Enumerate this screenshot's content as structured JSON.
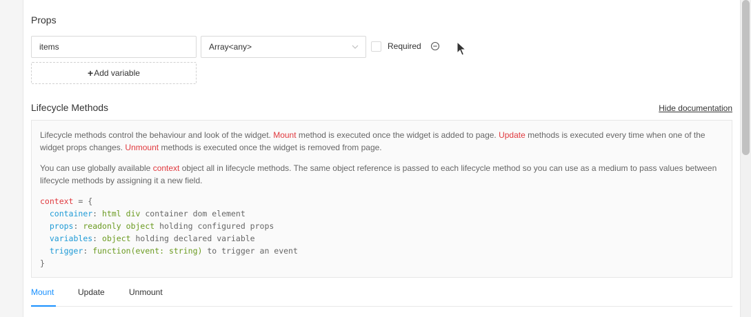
{
  "props": {
    "title": "Props",
    "rows": [
      {
        "name": "items",
        "type": "Array<any>",
        "required_label": "Required",
        "required": false
      }
    ],
    "add_variable_label": "Add variable"
  },
  "lifecycle": {
    "title": "Lifecycle Methods",
    "hide_doc_label": "Hide documentation",
    "para1": {
      "t1": "Lifecycle methods control the behaviour and look of the widget. ",
      "mount": "Mount",
      "t2": " method is executed once the widget is added to page. ",
      "update": "Update",
      "t3": " methods is executed every time when one of the widget props changes. ",
      "unmount": "Unmount",
      "t4": " methods is executed once the widget is removed from page."
    },
    "para2": {
      "t1": "You can use globally available ",
      "context": "context",
      "t2": " object all in lifecycle methods. The same object reference is passed to each lifecycle method so you can use as a medium to pass values between lifecycle methods by assigning it a new field."
    },
    "code": {
      "l1_var": "context",
      "l1_rest": " = {",
      "l2_key": "container",
      "l2_colon": ": ",
      "l2_type": "html div",
      "l2_rest": " container dom element",
      "l3_key": "props",
      "l3_colon": ": ",
      "l3_type": "readonly object",
      "l3_rest": " holding configured props",
      "l4_key": "variables",
      "l4_colon": ": ",
      "l4_type": "object",
      "l4_rest": " holding declared variable",
      "l5_key": "trigger",
      "l5_colon": ": ",
      "l5_type": "function(event: string)",
      "l5_rest": " to trigger an event",
      "l6": "}"
    }
  },
  "tabs": [
    {
      "label": "Mount",
      "active": true
    },
    {
      "label": "Update",
      "active": false
    },
    {
      "label": "Unmount",
      "active": false
    }
  ],
  "colors": {
    "accent": "#1890ff",
    "highlight_red": "#e0393e",
    "code_blue": "#1e9ad6",
    "code_green": "#6a9a1f"
  },
  "icons": {
    "dropdown": "chevron-down-icon",
    "remove": "minus-circle-icon",
    "add": "plus-icon",
    "cursor": "mouse-cursor-icon"
  }
}
